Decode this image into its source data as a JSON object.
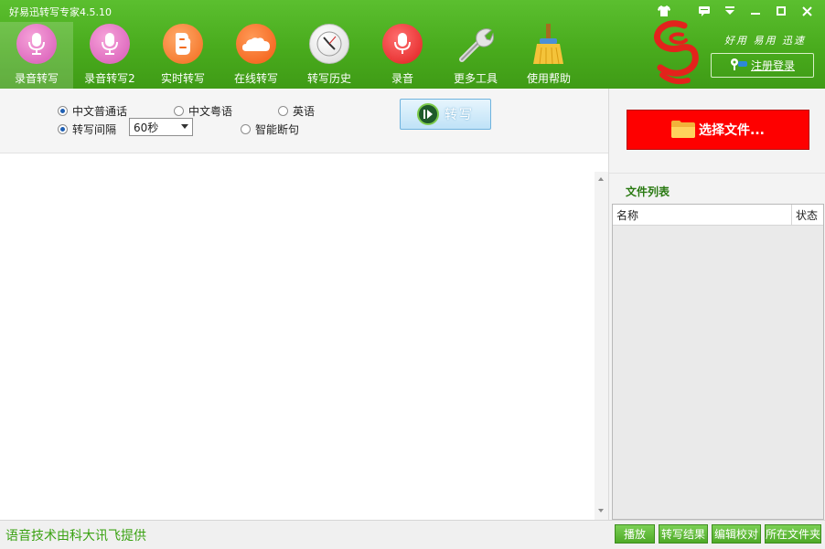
{
  "app": {
    "title": "好易迅转写专家4.5.10"
  },
  "toolbar": {
    "items": [
      {
        "label": "录音转写",
        "icon": "microphone-pink-icon",
        "active": true
      },
      {
        "label": "录音转写2",
        "icon": "microphone-pink-icon"
      },
      {
        "label": "实时转写",
        "icon": "blogger-icon"
      },
      {
        "label": "在线转写",
        "icon": "cloud-icon"
      },
      {
        "label": "转写历史",
        "icon": "clock-icon"
      },
      {
        "label": "录音",
        "icon": "microphone-red-icon"
      },
      {
        "label": "更多工具",
        "icon": "wrench-icon"
      },
      {
        "label": "使用帮助",
        "icon": "broom-icon"
      }
    ]
  },
  "brand": {
    "slogan": "好用 易用 迅速",
    "register_label": "注册登录"
  },
  "options": {
    "languages": [
      {
        "label": "中文普通话",
        "selected": true
      },
      {
        "label": "中文粤语",
        "selected": false
      },
      {
        "label": "英语",
        "selected": false
      }
    ],
    "interval": {
      "label": "转写间隔",
      "selected": true,
      "value": "60秒"
    },
    "smart_break": {
      "label": "智能断句",
      "selected": false
    },
    "transcribe_label": "转写"
  },
  "right_panel": {
    "choose_file_label": "选择文件...",
    "file_list_title": "文件列表",
    "columns": [
      "名称",
      "状态"
    ],
    "files": []
  },
  "footer": {
    "credit": "语音技术由科大讯飞提供",
    "buttons": [
      "播放",
      "转写结果",
      "编辑校对",
      "所在文件夹"
    ]
  },
  "colors": {
    "header_green": "#49ab1d",
    "choose_file_red": "#fe0000",
    "credit_green": "#3aa212",
    "list_title_green": "#2a7a12"
  }
}
